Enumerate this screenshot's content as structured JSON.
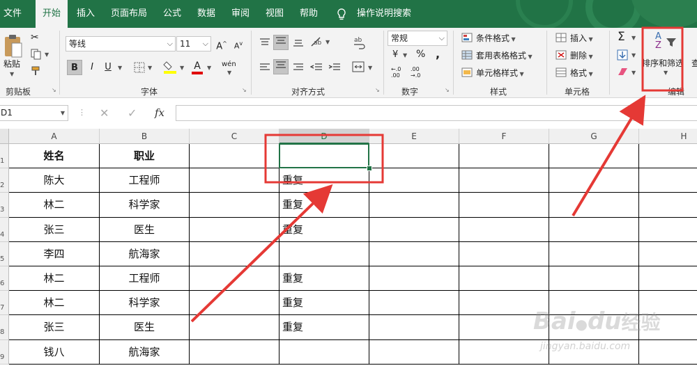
{
  "tabs": [
    "文件",
    "开始",
    "插入",
    "页面布局",
    "公式",
    "数据",
    "审阅",
    "视图",
    "帮助"
  ],
  "tell_me": "操作说明搜索",
  "clipboard": {
    "paste": "粘贴",
    "label": "剪贴板"
  },
  "font": {
    "name": "等线",
    "size": "11",
    "label": "字体",
    "bold": "B",
    "italic": "I",
    "underline": "U",
    "grow": "A",
    "shrink": "A",
    "color_letter": "A",
    "phonetic": "wén"
  },
  "alignment": {
    "label": "对齐方式"
  },
  "number": {
    "format": "常规",
    "label": "数字",
    "currency": "¥",
    "percent": "%",
    "comma": ",",
    "inc_dec": "←.0 .00",
    "dec_dec": ".00 →.0"
  },
  "styles": {
    "cond": "条件格式",
    "table": "套用表格格式",
    "cell": "单元格样式",
    "label": "样式"
  },
  "cells": {
    "insert": "插入",
    "delete": "删除",
    "format": "格式",
    "label": "单元格"
  },
  "editing": {
    "sum": "Σ",
    "sort_filter": "排序和筛选",
    "find_partial": "查",
    "label": "编辑",
    "sort_top": "A",
    "sort_bottom": "Z"
  },
  "formula_bar": {
    "name_box": "D1",
    "cancel": "✕",
    "enter": "✓",
    "fx": "fx",
    "value": ""
  },
  "columns": [
    "A",
    "B",
    "C",
    "D",
    "E",
    "F",
    "G",
    "H"
  ],
  "row_numbers": [
    "1",
    "2",
    "3",
    "4",
    "5",
    "6",
    "7",
    "8",
    "9"
  ],
  "rows": [
    {
      "a": "姓名",
      "b": "职业",
      "d": ""
    },
    {
      "a": "陈大",
      "b": "工程师",
      "d": "重复"
    },
    {
      "a": "林二",
      "b": "科学家",
      "d": "重复"
    },
    {
      "a": "张三",
      "b": "医生",
      "d": "重复"
    },
    {
      "a": "李四",
      "b": "航海家",
      "d": ""
    },
    {
      "a": "林二",
      "b": "工程师",
      "d": "重复"
    },
    {
      "a": "林二",
      "b": "科学家",
      "d": "重复"
    },
    {
      "a": "张三",
      "b": "医生",
      "d": "重复"
    },
    {
      "a": "钱八",
      "b": "航海家",
      "d": ""
    }
  ],
  "watermark": {
    "brand": "Bai",
    "paw": "du",
    "cn": "经验",
    "url": "jingyan.baidu.com"
  },
  "colors": {
    "excel_green": "#217346",
    "annotation_red": "#e53935",
    "selection_green": "#217346"
  }
}
